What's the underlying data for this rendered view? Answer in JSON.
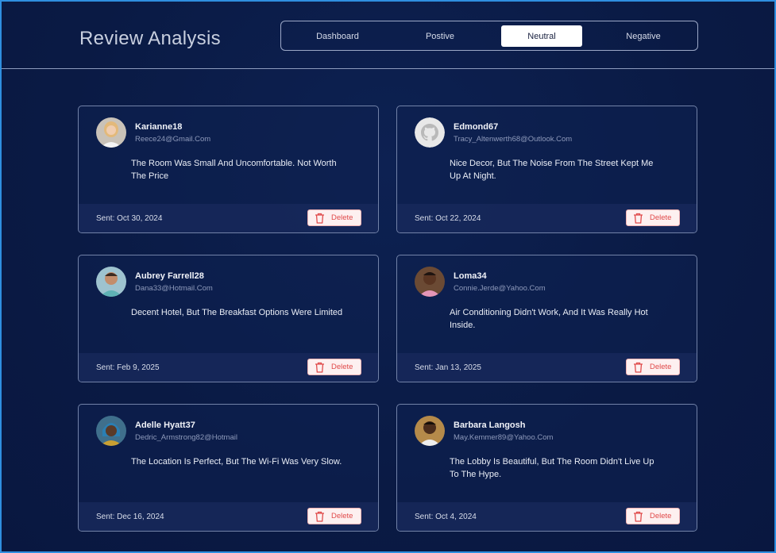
{
  "header": {
    "title": "Review Analysis",
    "tabs": [
      {
        "label": "Dashboard",
        "active": false
      },
      {
        "label": "Postive",
        "active": false
      },
      {
        "label": "Neutral",
        "active": true
      },
      {
        "label": "Negative",
        "active": false
      }
    ]
  },
  "reviews": [
    {
      "name": "Karianne18",
      "email": "Reece24@Gmail.Com",
      "review": "The Room Was Small And Uncomfortable. Not Worth The Price",
      "sent": "Sent: Oct 30, 2024",
      "avatar": "woman-blonde-avatar",
      "delete_label": "Delete"
    },
    {
      "name": "Edmond67",
      "email": "Tracy_Altenwerth68@Outlook.Com",
      "review": "Nice Decor, But The Noise From The Street Kept Me Up At Night.",
      "sent": "Sent: Oct 22, 2024",
      "avatar": "github-avatar",
      "delete_label": "Delete"
    },
    {
      "name": "Aubrey Farrell28",
      "email": "Dana33@Hotmail.Com",
      "review": "Decent Hotel, But The Breakfast Options Were Limited",
      "sent": "Sent: Feb 9, 2025",
      "avatar": "man-smiling-avatar",
      "delete_label": "Delete"
    },
    {
      "name": "Loma34",
      "email": "Connie.Jerde@Yahoo.Com",
      "review": "Air Conditioning Didn't Work, And It Was Really Hot Inside.",
      "sent": "Sent: Jan 13, 2025",
      "avatar": "woman-dark-avatar",
      "delete_label": "Delete"
    },
    {
      "name": "Adelle Hyatt37",
      "email": "Dedric_Armstrong82@Hotmail",
      "review": "The Location Is Perfect, But The Wi-Fi Was Very Slow.",
      "sent": "Sent: Dec 16, 2024",
      "avatar": "woman-headwrap-avatar",
      "delete_label": "Delete"
    },
    {
      "name": "Barbara Langosh",
      "email": "May.Kemmer89@Yahoo.Com",
      "review": "The Lobby Is Beautiful, But The Room Didn't Live Up To The Hype.",
      "sent": "Sent: Oct 4, 2024",
      "avatar": "man-portrait-avatar",
      "delete_label": "Delete"
    }
  ],
  "colors": {
    "background": "#0a1b45",
    "frame_border": "#2f8fe0",
    "delete_text": "#e04a4a",
    "delete_bg": "#fdf0f0"
  }
}
